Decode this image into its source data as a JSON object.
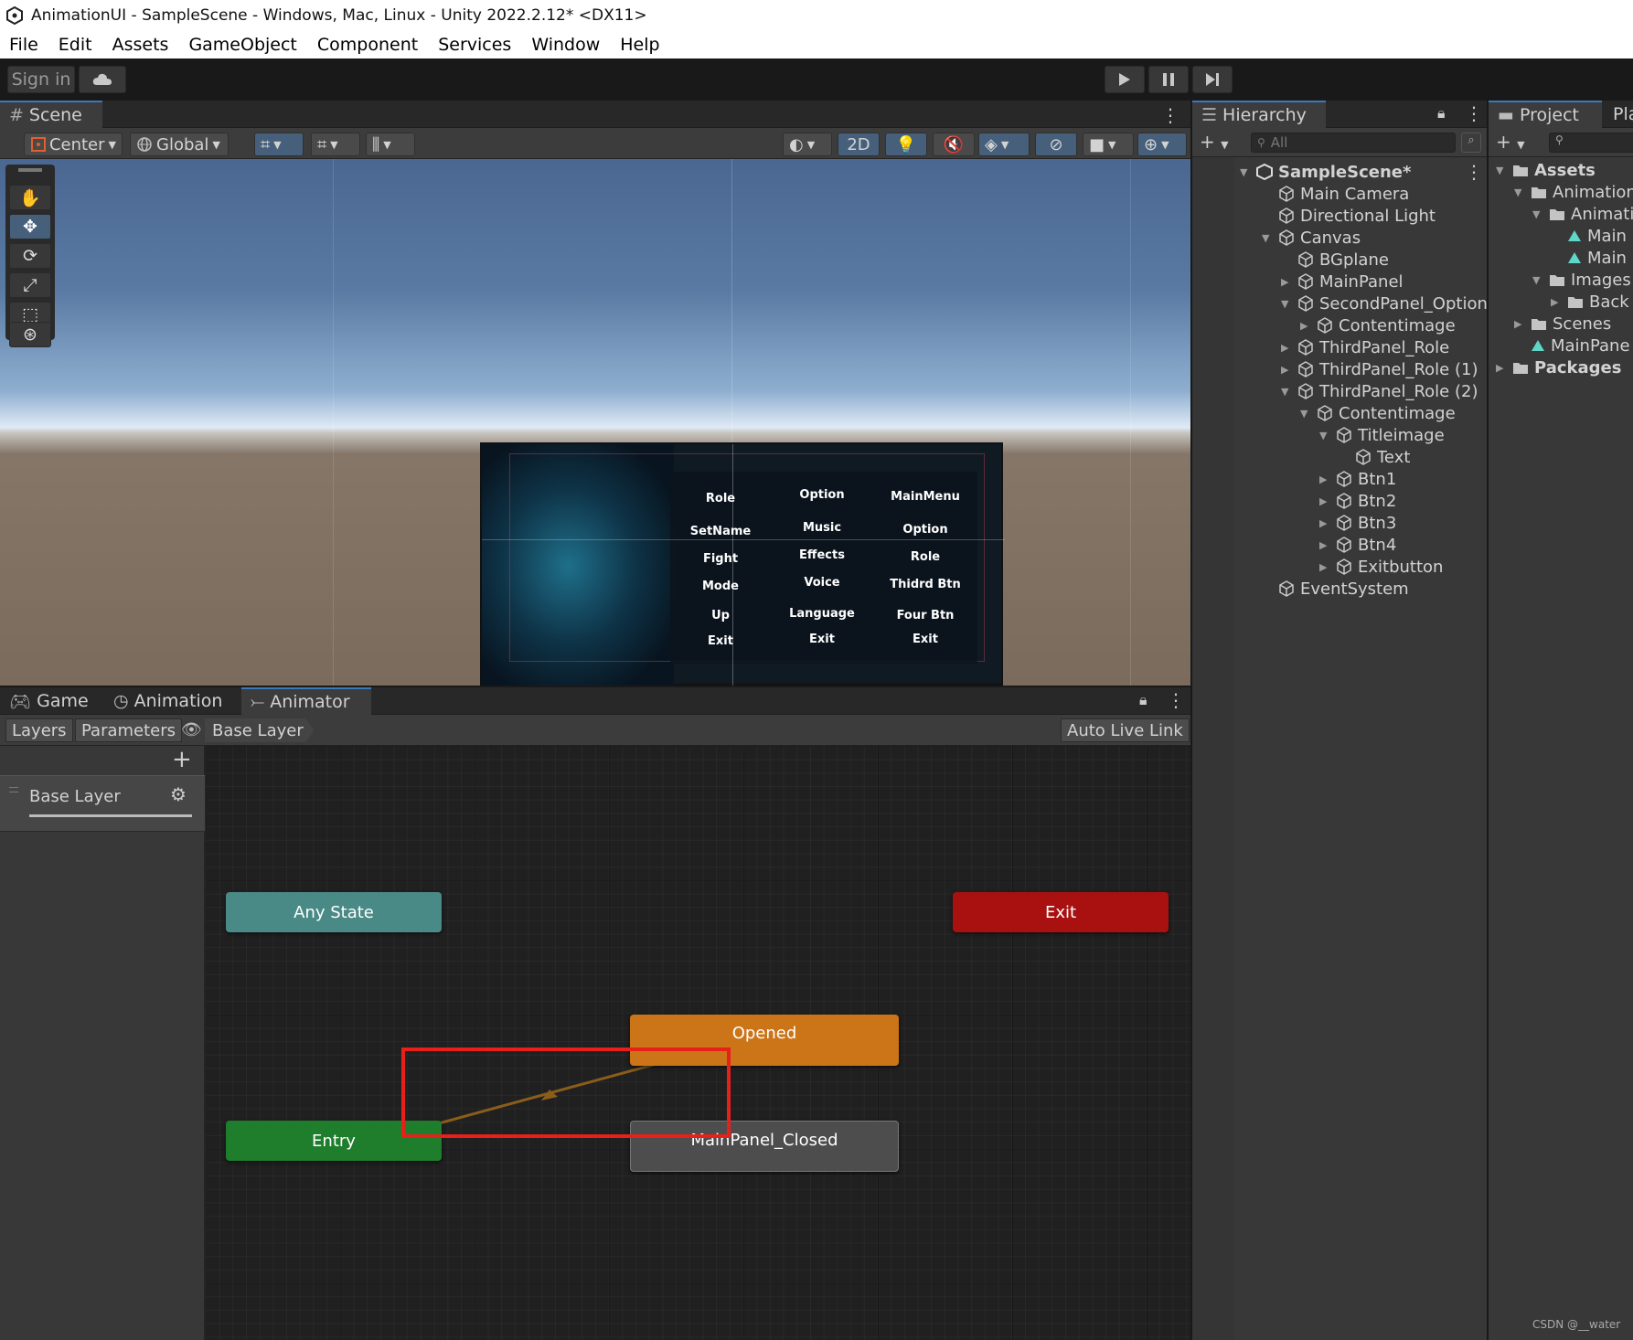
{
  "window_title": "AnimationUI - SampleScene - Windows, Mac, Linux - Unity 2022.2.12* <DX11>",
  "menu": [
    "File",
    "Edit",
    "Assets",
    "GameObject",
    "Component",
    "Services",
    "Window",
    "Help"
  ],
  "toolbar": {
    "sign_in": "Sign in",
    "cloud_icon": "cloud-icon",
    "play_icon": "play-icon",
    "pause_icon": "pause-icon",
    "step_icon": "step-icon"
  },
  "scene": {
    "tab_label": "Scene",
    "pivot_label": "Center",
    "space_label": "Global",
    "mode_2d": "2D",
    "ui_preview": {
      "col1": [
        "Role",
        "SetName",
        "Fight",
        "Mode",
        "Up",
        "Exit"
      ],
      "col2": [
        "Option",
        "Music",
        "Effects",
        "Voice",
        "Language",
        "Exit"
      ],
      "col3": [
        "MainMenu",
        "Option",
        "Role",
        "Thidrd Btn",
        "Four Btn",
        "Exit"
      ]
    }
  },
  "hierarchy": {
    "tab_label": "Hierarchy",
    "search_placeholder": "All",
    "scene_name": "SampleScene*",
    "items": [
      {
        "label": "Main Camera",
        "arrow": ""
      },
      {
        "label": "Directional Light",
        "arrow": ""
      },
      {
        "label": "Canvas",
        "arrow": "▼"
      },
      {
        "label": "BGplane",
        "arrow": ""
      },
      {
        "label": "MainPanel",
        "arrow": "▶"
      },
      {
        "label": "SecondPanel_Option",
        "arrow": "▼"
      },
      {
        "label": "Contentimage",
        "arrow": "▶"
      },
      {
        "label": "ThirdPanel_Role",
        "arrow": "▶"
      },
      {
        "label": "ThirdPanel_Role (1)",
        "arrow": "▶"
      },
      {
        "label": "ThirdPanel_Role (2)",
        "arrow": "▼"
      },
      {
        "label": "Contentimage",
        "arrow": "▼"
      },
      {
        "label": "Titleimage",
        "arrow": "▼"
      },
      {
        "label": "Text",
        "arrow": ""
      },
      {
        "label": "Btn1",
        "arrow": "▶"
      },
      {
        "label": "Btn2",
        "arrow": "▶"
      },
      {
        "label": "Btn3",
        "arrow": "▶"
      },
      {
        "label": "Btn4",
        "arrow": "▶"
      },
      {
        "label": "Exitbutton",
        "arrow": "▶"
      },
      {
        "label": "EventSystem",
        "arrow": ""
      }
    ]
  },
  "project": {
    "tab_label": "Project",
    "tab2_label": "Pla",
    "items": [
      {
        "label": "Assets",
        "arrow": "▼",
        "bold": true
      },
      {
        "label": "Animation",
        "arrow": "▼"
      },
      {
        "label": "Animati",
        "arrow": "▼"
      },
      {
        "label": "Main",
        "arrow": ""
      },
      {
        "label": "Main",
        "arrow": ""
      },
      {
        "label": "Images",
        "arrow": "▼"
      },
      {
        "label": "Back",
        "arrow": "▶"
      },
      {
        "label": "Scenes",
        "arrow": "▶"
      },
      {
        "label": "MainPane",
        "arrow": ""
      },
      {
        "label": "Packages",
        "arrow": "▶",
        "bold": true
      }
    ]
  },
  "bottom_tabs": {
    "game": "Game",
    "animation": "Animation",
    "animator": "Animator"
  },
  "animator": {
    "layers_tab": "Layers",
    "parameters_tab": "Parameters",
    "breadcrumb": "Base Layer",
    "auto_live_link": "Auto Live Link",
    "layer_name": "Base Layer",
    "states": {
      "any_state": "Any State",
      "exit": "Exit",
      "opened": "Opened",
      "entry": "Entry",
      "closed": "MainPanel_Closed"
    },
    "colors": {
      "any_state": "#4a8a86",
      "exit": "#a8110f",
      "opened": "#cc7418",
      "entry": "#1e7e2c",
      "closed": "#4d4d4d",
      "highlight": "#e8201a"
    }
  },
  "watermark": "CSDN @__water"
}
